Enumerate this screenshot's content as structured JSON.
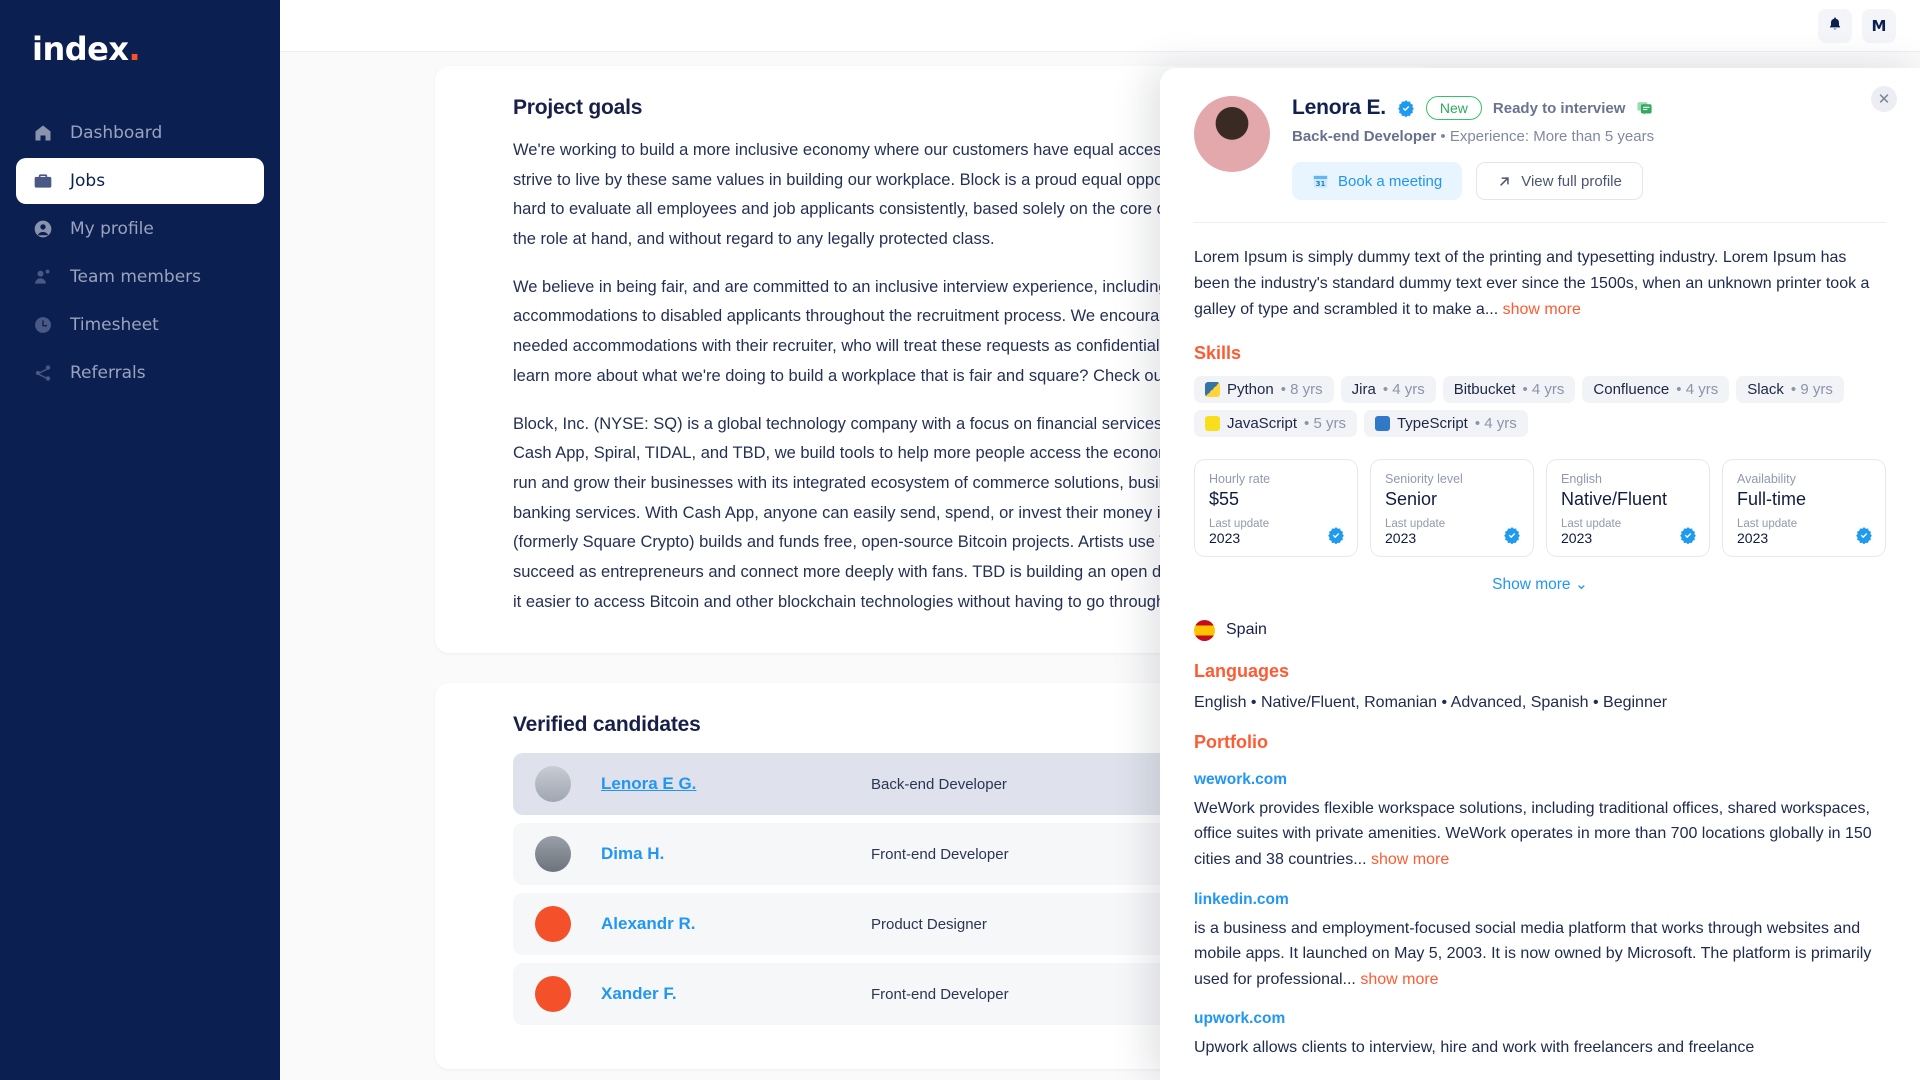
{
  "brand": {
    "name": "index",
    "dot": "."
  },
  "sidebar": {
    "items": [
      {
        "label": "Dashboard",
        "icon": "home-icon",
        "active": false
      },
      {
        "label": "Jobs",
        "icon": "briefcase-icon",
        "active": true
      },
      {
        "label": "My profile",
        "icon": "user-icon",
        "active": false
      },
      {
        "label": "Team members",
        "icon": "users-icon",
        "active": false
      },
      {
        "label": "Timesheet",
        "icon": "clock-icon",
        "active": false
      },
      {
        "label": "Referrals",
        "icon": "share-icon",
        "active": false
      }
    ]
  },
  "topbar": {
    "notifications_icon": "bell-icon",
    "avatar_initial": "M"
  },
  "job": {
    "goals_title": "Project goals",
    "paragraphs": [
      "We're working to build a more inclusive economy where our customers have equal access to opportunity, and we strive to live by these same values in building our workplace. Block is a proud equal opportunity employer. We work hard to evaluate all employees and job applicants consistently, based solely on the core competencies required of the role at hand, and without regard to any legally protected class.",
      "We believe in being fair, and are committed to an inclusive interview experience, including providing reasonable accommodations to disabled applicants throughout the recruitment process. We encourage applicants to share any needed accommodations with their recruiter, who will treat these requests as confidentially as possible. Want to learn more about what we're doing to build a workplace that is fair and square? Check out our I+D page.",
      "Block, Inc. (NYSE: SQ) is a global technology company with a focus on financial services. Made up of Square, Cash App, Spiral, TIDAL, and TBD, we build tools to help more people access the economy. Square helps sellers run and grow their businesses with its integrated ecosystem of commerce solutions, business software, and banking services. With Cash App, anyone can easily send, spend, or invest their money in stocks or Bitcoin. Spiral (formerly Square Crypto) builds and funds free, open-source Bitcoin projects. Artists use TIDAL to help them succeed as entrepreneurs and connect more deeply with fans. TBD is building an open developer platform to make it easier to access Bitcoin and other blockchain technologies without having to go through an institution."
    ],
    "candidates_title": "Verified candidates",
    "candidates": [
      {
        "name": "Lenora E G.",
        "role": "Back-end Developer",
        "selected": true
      },
      {
        "name": "Dima H.",
        "role": "Front-end Developer",
        "selected": false
      },
      {
        "name": "Alexandr R.",
        "role": "Product Designer",
        "selected": false
      },
      {
        "name": "Xander F.",
        "role": "Front-end Developer",
        "selected": false
      }
    ]
  },
  "modal": {
    "close_icon": "close-icon",
    "name": "Lenora E.",
    "verified_icon": "verified-badge-icon",
    "badge_new": "New",
    "ready_text": "Ready to interview",
    "ready_icon": "chat-bubble-icon",
    "role": "Back-end Developer",
    "experience": "• Experience: More than 5 years",
    "book_button": "Book a meeting",
    "book_icon": "calendar-icon",
    "profile_button": "View full profile",
    "profile_icon": "arrow-up-right-icon",
    "bio": "Lorem Ipsum is simply dummy text of the printing and typesetting industry. Lorem Ipsum has been the industry's standard dummy text ever since the 1500s, when an unknown printer took a galley of type and scrambled it to make a...",
    "bio_showmore": "show more",
    "skills_title": "Skills",
    "skills": [
      {
        "name": "Python",
        "years": "• 8 yrs",
        "icon": "python-icon",
        "color": "#3572A5"
      },
      {
        "name": "Jira",
        "years": "• 4 yrs",
        "icon": null,
        "color": null
      },
      {
        "name": "Bitbucket",
        "years": "• 4 yrs",
        "icon": null,
        "color": null
      },
      {
        "name": "Confluence",
        "years": "• 4 yrs",
        "icon": null,
        "color": null
      },
      {
        "name": "Slack",
        "years": "• 9 yrs",
        "icon": null,
        "color": null
      },
      {
        "name": "JavaScript",
        "years": "• 5 yrs",
        "icon": "javascript-icon",
        "color": "#F7DF1E"
      },
      {
        "name": "TypeScript",
        "years": "• 4 yrs",
        "icon": "typescript-icon",
        "color": "#3178C6"
      }
    ],
    "infocards": [
      {
        "label": "Hourly rate",
        "value": "$55",
        "update_label": "Last update",
        "year": "2023",
        "verified": true
      },
      {
        "label": "Seniority level",
        "value": "Senior",
        "update_label": "Last update",
        "year": "2023",
        "verified": true
      },
      {
        "label": "English",
        "value": "Native/Fluent",
        "update_label": "Last update",
        "year": "2023",
        "verified": true
      },
      {
        "label": "Availability",
        "value": "Full-time",
        "update_label": "Last update",
        "year": "2023",
        "verified": true
      }
    ],
    "show_more": "Show more",
    "show_more_icon": "chevron-down-icon",
    "country": "Spain",
    "country_flag": "spain-flag-icon",
    "languages_title": "Languages",
    "languages": "English • Native/Fluent, Romanian • Advanced, Spanish • Beginner",
    "portfolio_title": "Portfolio",
    "portfolio": [
      {
        "url": "wework.com",
        "desc": "WeWork provides flexible workspace solutions, including traditional offices, shared workspaces, office suites with private amenities. WeWork operates in more than 700 locations globally in 150 cities and 38 countries...",
        "showmore": "show more"
      },
      {
        "url": "linkedin.com",
        "desc": "is a business and employment-focused social media platform that works through websites and mobile apps. It launched on May 5, 2003. It is now owned by Microsoft. The platform is primarily used for professional...",
        "showmore": "show more"
      },
      {
        "url": "upwork.com",
        "desc": "Upwork allows clients to interview, hire and work with freelancers and freelance",
        "showmore": ""
      }
    ]
  },
  "colors": {
    "brand_navy": "#0b1f51",
    "accent_orange": "#ff5b33",
    "link_blue": "#2196f3",
    "green": "#37c06a"
  }
}
